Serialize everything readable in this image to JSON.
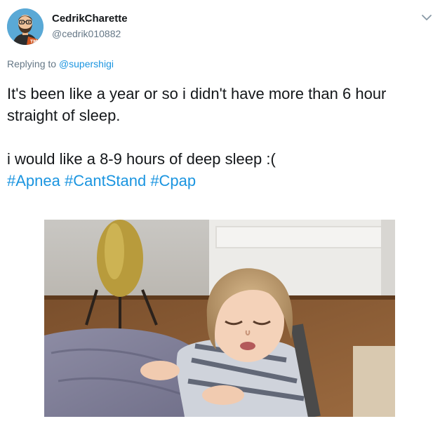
{
  "user": {
    "display_name": "CedrikCharette",
    "handle": "@cedrik010882",
    "avatar_icon": "cartoon-avatar-icon"
  },
  "menu": {
    "icon": "chevron-down-icon"
  },
  "reply": {
    "prefix": "Replying to",
    "mention": "@supershigi"
  },
  "tweet": {
    "line1": "It's been like a year or so i didn't have more than 6 hour",
    "line2": "straight of sleep.",
    "line3": "i would like a 8-9 hours of deep sleep :(",
    "hashtags": [
      "#Apnea",
      "#CantStand",
      "#Cpap"
    ]
  },
  "colors": {
    "link": "#1b95e0",
    "secondary_text": "#657786",
    "primary_text": "#14171a"
  }
}
